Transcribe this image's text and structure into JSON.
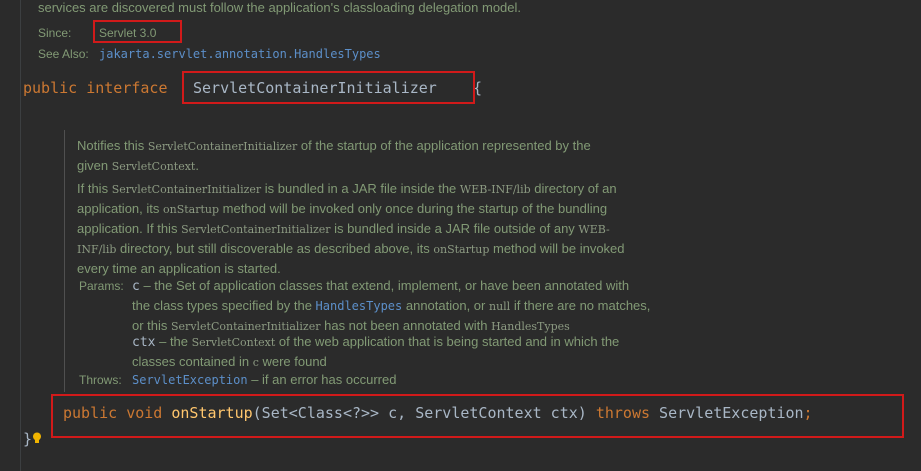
{
  "top": {
    "intro_text": "services are discovered must follow the application's classloading delegation model.",
    "since_label": "Since:",
    "since_value": "Servlet 3.0",
    "see_also_label": "See Also:",
    "see_also_link": "jakarta.servlet.annotation.HandlesTypes"
  },
  "declaration": {
    "kw_public": "public",
    "kw_interface": "interface",
    "name": "ServletContainerInitializer",
    "brace_open": "{",
    "brace_close": "}"
  },
  "javadoc": {
    "p1": {
      "a": "Notifies this ",
      "b": "ServletContainerInitializer",
      "c": " of the startup of the application represented by the",
      "d": "given ",
      "e": "ServletContext",
      "f": "."
    },
    "p2": {
      "l1a": "If this ",
      "l1b": "ServletContainerInitializer",
      "l1c": " is bundled in a JAR file inside the ",
      "l1d": "WEB-INF/lib",
      "l1e": " directory of an",
      "l2a": "application, its ",
      "l2b": "onStartup",
      "l2c": " method will be invoked only once during the startup of the bundling",
      "l3a": "application. If this ",
      "l3b": "ServletContainerInitializer",
      "l3c": " is bundled inside a JAR file outside of any ",
      "l3d": "WEB-",
      "l4a": "INF/lib",
      "l4b": " directory, but still discoverable as described above, its ",
      "l4c": "onStartup",
      "l4d": " method will be invoked",
      "l5": "every time an application is started."
    },
    "params": {
      "label": "Params:",
      "c_name": "c",
      "c_l1": " – the Set of application classes that extend, implement, or have been annotated with",
      "c_l2a": "the class types specified by the ",
      "c_l2b": "HandlesTypes",
      "c_l2c": " annotation, or ",
      "c_l2d": "null",
      "c_l2e": " if there are no matches,",
      "c_l3a": "or this ",
      "c_l3b": "ServletContainerInitializer",
      "c_l3c": " has not been annotated with ",
      "c_l3d": "HandlesTypes",
      "ctx_name": "ctx",
      "ctx_l1a": " – the ",
      "ctx_l1b": "ServletContext",
      "ctx_l1c": " of the web application that is being started and in which the",
      "ctx_l2a": "classes contained in ",
      "ctx_l2b": "c",
      "ctx_l2c": " were found"
    },
    "throws": {
      "label": "Throws:",
      "link": "ServletException",
      "text": " – if an error has occurred"
    }
  },
  "method": {
    "kw_public": "public",
    "kw_void": "void",
    "name": "onStartup",
    "params": "(Set<Class<?>> c, ServletContext ctx)",
    "kw_throws": "throws",
    "exception": "ServletException",
    "semicolon": ";"
  },
  "colors": {
    "background": "#2b2b2b",
    "doc_text": "#829a75",
    "keyword": "#cc7832",
    "method": "#ffc66d",
    "plain": "#a9b7c6",
    "link": "#5c8fc9",
    "highlight_box": "#d11a1a"
  },
  "icons": {
    "intention": "lightbulb-icon"
  }
}
